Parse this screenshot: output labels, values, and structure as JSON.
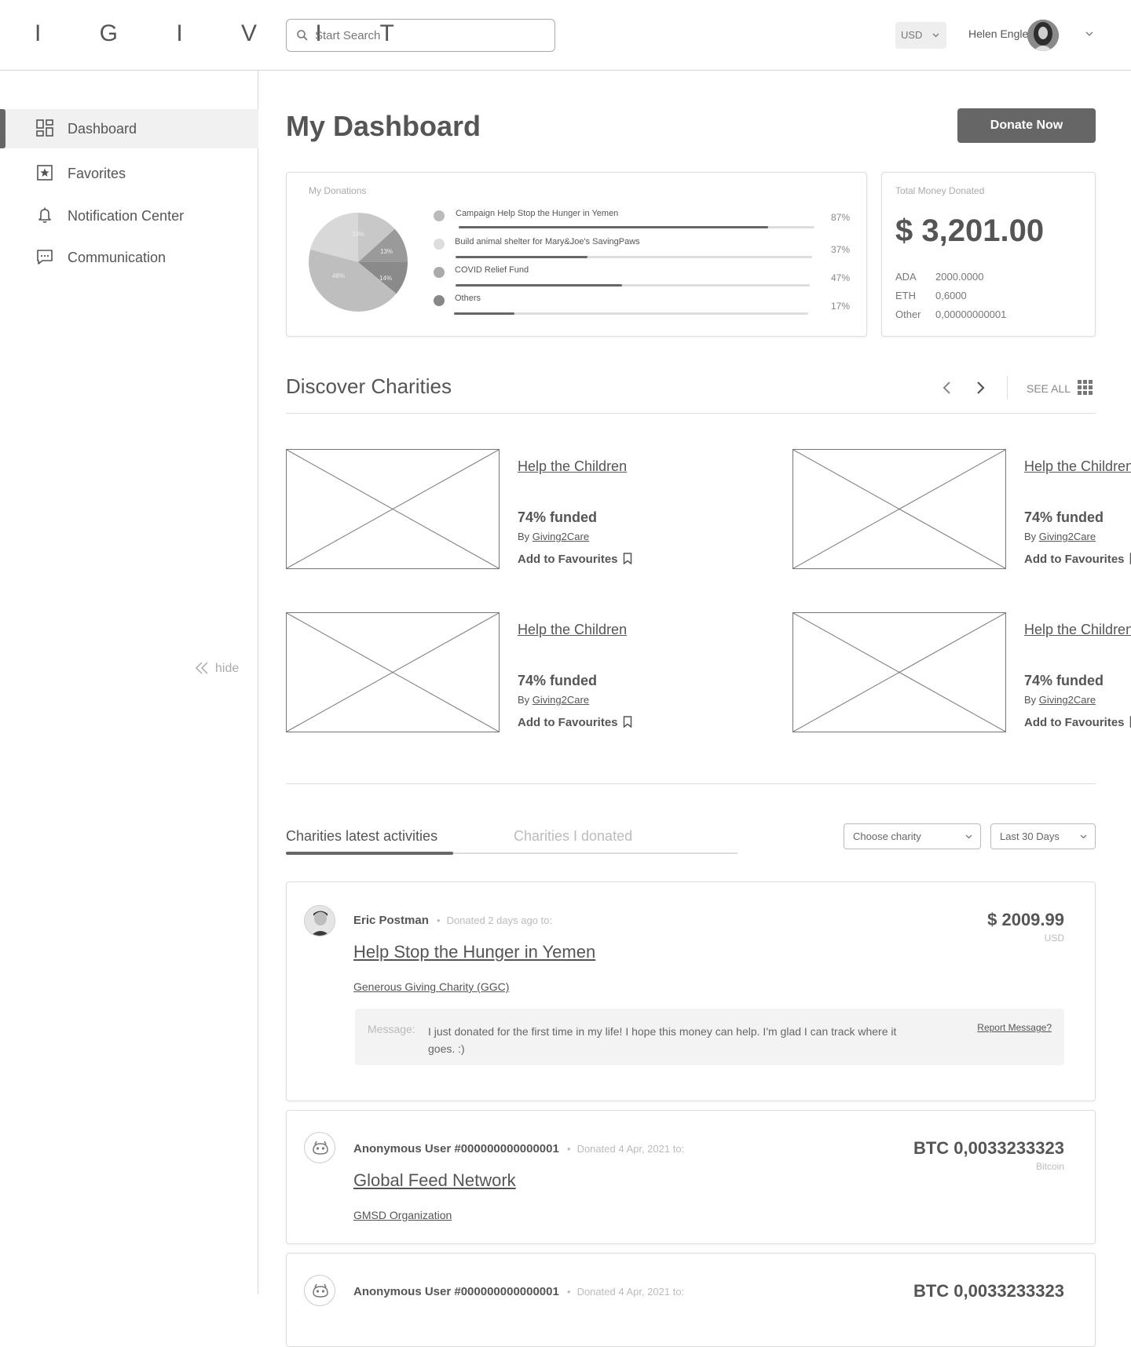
{
  "header": {
    "logo": "I G I V I T",
    "search_placeholder": "Start Search",
    "currency": "USD",
    "user_name": "Helen Engleford"
  },
  "sidebar": {
    "items": [
      {
        "label": "Dashboard",
        "icon": "dashboard-icon",
        "active": true
      },
      {
        "label": "Favorites",
        "icon": "star-icon",
        "active": false
      },
      {
        "label": "Notification Center",
        "icon": "bell-icon",
        "active": false
      },
      {
        "label": "Communication",
        "icon": "chat-icon",
        "active": false
      }
    ],
    "hide_label": "hide"
  },
  "main": {
    "title": "My Dashboard",
    "donate_button": "Donate Now"
  },
  "donations": {
    "label": "My Donations",
    "pie_labels": [
      "33%",
      "13%",
      "14%",
      "48%"
    ],
    "items": [
      {
        "name": "Campaign Help Stop the Hunger in Yemen",
        "percent": "87%",
        "fill": 0.87,
        "dot_color": "#bbbbbb"
      },
      {
        "name": "Build animal shelter for Mary&Joe's SavingPaws",
        "percent": "37%",
        "fill": 0.37,
        "dot_color": "#dddddd"
      },
      {
        "name": "COVID Relief Fund",
        "percent": "47%",
        "fill": 0.47,
        "dot_color": "#aaaaaa"
      },
      {
        "name": "Others",
        "percent": "17%",
        "fill": 0.17,
        "dot_color": "#888888"
      }
    ]
  },
  "total": {
    "label": "Total Money Donated",
    "amount": "$ 3,201.00",
    "crypto": [
      {
        "code": "ADA",
        "value": "2000.0000"
      },
      {
        "code": "ETH",
        "value": "0,6000"
      },
      {
        "code": "Other",
        "value": "0,00000000001"
      }
    ]
  },
  "discover": {
    "title": "Discover Charities",
    "see_all": "SEE ALL",
    "charities": [
      {
        "title": "Help the Children",
        "funded": "74% funded",
        "by": "By",
        "org": "Giving2Care",
        "fav": "Add to Favourites"
      },
      {
        "title": "Help the Children",
        "funded": "74% funded",
        "by": "By",
        "org": "Giving2Care",
        "fav": "Add to Favourites"
      },
      {
        "title": "Help the Children",
        "funded": "74% funded",
        "by": "By",
        "org": "Giving2Care",
        "fav": "Add to Favourites"
      },
      {
        "title": "Help the Children",
        "funded": "74% funded",
        "by": "By",
        "org": "Giving2Care",
        "fav": "Add to Favourites"
      }
    ]
  },
  "activities": {
    "tabs": [
      "Charities latest activities",
      "Charities I donated"
    ],
    "filter_charity": "Choose charity",
    "filter_period": "Last 30 Days",
    "items": [
      {
        "user": "Eric Postman",
        "meta": "Donated 2 days ago to:",
        "title": "Help Stop the Hunger in Yemen",
        "org": "Generous Giving Charity (GGC)",
        "amount": "$ 2009.99",
        "currency": "USD",
        "message_label": "Message:",
        "message": "I just donated for the first time in my life! I hope this money can help. I'm glad I can track where it goes. :)",
        "report": "Report Message?"
      },
      {
        "user": "Anonymous User #000000000000001",
        "meta": "Donated 4 Apr, 2021 to:",
        "title": "Global Feed Network",
        "org": "GMSD Organization",
        "amount": "BTC 0,0033233323",
        "currency": "Bitcoin"
      },
      {
        "user": "Anonymous User #000000000000001",
        "meta": "Donated 4 Apr, 2021 to:",
        "amount": "BTC 0,0033233323"
      }
    ]
  }
}
